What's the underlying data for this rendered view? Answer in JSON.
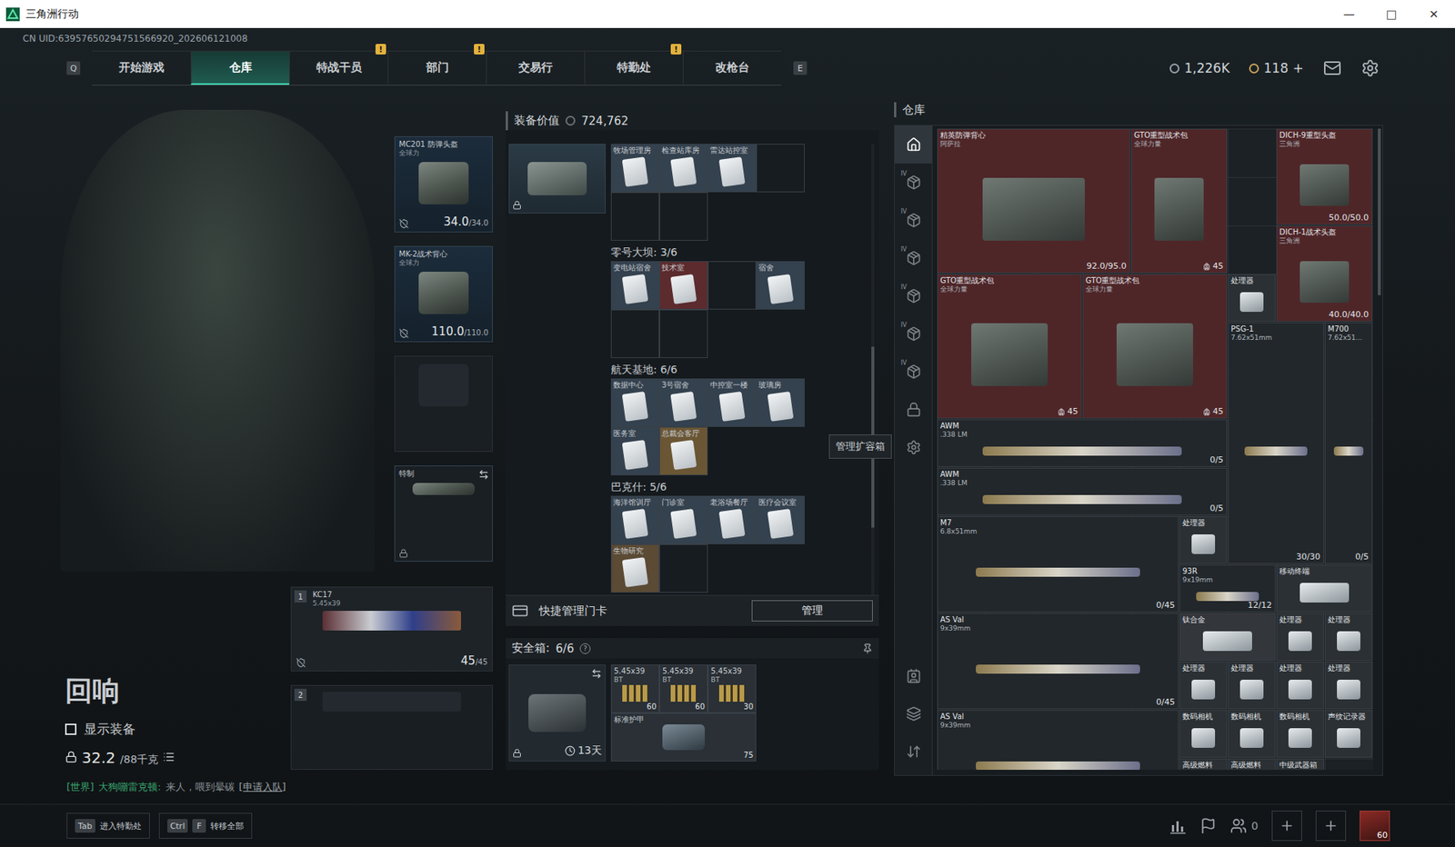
{
  "window": {
    "title": "三角洲行动",
    "controls": [
      "—",
      "□",
      "✕"
    ]
  },
  "uid": "CN UID:63957650294751566920_202606121008",
  "nav": {
    "prev_key": "Q",
    "next_key": "E",
    "alert_mark": "!",
    "tabs": [
      {
        "label": "开始游戏",
        "selected": false,
        "alert": false
      },
      {
        "label": "仓库",
        "selected": true,
        "alert": false
      },
      {
        "label": "特战干员",
        "selected": false,
        "alert": true
      },
      {
        "label": "部门",
        "selected": false,
        "alert": true
      },
      {
        "label": "交易行",
        "selected": false,
        "alert": false
      },
      {
        "label": "特勤处",
        "selected": false,
        "alert": true
      },
      {
        "label": "改枪台",
        "selected": false,
        "alert": false
      }
    ]
  },
  "currencies": [
    {
      "value": "1,226K",
      "color": "#9aa3ab"
    },
    {
      "value": "118",
      "add": "+",
      "color": "#c9a45a"
    }
  ],
  "loadout": {
    "gear": [
      {
        "kind": "armor",
        "name": "MC201 防弹头盔",
        "faction": "全球力",
        "reading": "34.0",
        "max": "/34.0"
      },
      {
        "kind": "armor",
        "name": "MK-2战术背心",
        "faction": "全球力",
        "reading": "110.0",
        "max": "/110.0"
      },
      {
        "kind": "empty"
      },
      {
        "kind": "melee",
        "name": "特制"
      }
    ],
    "weapons": [
      {
        "index": "1",
        "empty": false,
        "name": "KC17",
        "caliber": "5.45x39",
        "reading": "45",
        "max": "/45"
      },
      {
        "index": "2",
        "empty": true
      }
    ]
  },
  "operator": {
    "name": "回响",
    "show_gear": {
      "label": "显示装备",
      "checked": false
    },
    "weight": "32.2",
    "weight_max": "/88千克"
  },
  "chat": {
    "channel": "[世界]",
    "sender": "大狗嘣雷克顿:",
    "message": "来人，喂到晕碳",
    "action": "[申请入队]"
  },
  "stash_value": {
    "label": "装备价值",
    "value": "724,762"
  },
  "keycards": {
    "scroll_level": 0.45,
    "groups": [
      {
        "cards": [
          {
            "filled": true,
            "label": "牧场管理房",
            "color": "#34414e"
          },
          {
            "filled": true,
            "label": "检查站库房",
            "color": "#34414e"
          },
          {
            "filled": true,
            "label": "雷达站控室",
            "color": "#34414e"
          },
          {
            "filled": false
          },
          {
            "filled": false
          },
          {
            "filled": false
          }
        ]
      },
      {
        "heading": "零号大坝: 3/6",
        "cards": [
          {
            "filled": true,
            "label": "变电站宿舍",
            "color": "#34414e"
          },
          {
            "filled": true,
            "label": "技术室",
            "color": "#5c2b2e"
          },
          {
            "filled": false
          },
          {
            "filled": true,
            "label": "宿舍",
            "color": "#34414e"
          },
          {
            "filled": false
          },
          {
            "filled": false
          }
        ]
      },
      {
        "heading": "航天基地: 6/6",
        "cards": [
          {
            "filled": true,
            "label": "数据中心",
            "color": "#34414e"
          },
          {
            "filled": true,
            "label": "3号宿舍",
            "color": "#34414e"
          },
          {
            "filled": true,
            "label": "中控室一楼",
            "color": "#34414e"
          },
          {
            "filled": true,
            "label": "玻璃房",
            "color": "#34414e"
          },
          {
            "filled": true,
            "label": "医务室",
            "color": "#34414e"
          },
          {
            "filled": true,
            "label": "总裁会客厅",
            "color": "#6a5634"
          }
        ]
      },
      {
        "heading": "巴克什: 5/6",
        "cards": [
          {
            "filled": true,
            "label": "海洋馆训厅",
            "color": "#34414e"
          },
          {
            "filled": true,
            "label": "门诊室",
            "color": "#34414e"
          },
          {
            "filled": true,
            "label": "老浴场餐厅",
            "color": "#34414e"
          },
          {
            "filled": true,
            "label": "医疗会议室",
            "color": "#34414e"
          },
          {
            "filled": true,
            "label": "生物研究",
            "color": "#5b4a34"
          },
          {
            "filled": false
          }
        ]
      }
    ]
  },
  "quick_manage": {
    "label": "快捷管理门卡",
    "button": "管理"
  },
  "tooltip": "管理扩容箱",
  "safe_box": {
    "label": "安全箱:",
    "count": "6/6",
    "help": "?",
    "timer": "13天",
    "items": [
      {
        "kind": "ammo",
        "name": "5.45x39",
        "sub": "BT",
        "count": "60"
      },
      {
        "kind": "ammo",
        "name": "5.45x39",
        "sub": "BT",
        "count": "60"
      },
      {
        "kind": "ammo",
        "name": "5.45x39",
        "sub": "BT",
        "count": "30"
      },
      {
        "kind": "armor",
        "name": "标准护甲",
        "count": "75"
      }
    ]
  },
  "warehouse": {
    "title": "仓库",
    "sidebar": [
      {
        "kind": "home",
        "selected": true
      },
      {
        "kind": "box",
        "badge": "IV",
        "selected": false
      },
      {
        "kind": "box",
        "badge": "IV",
        "selected": false
      },
      {
        "kind": "box",
        "badge": "IV",
        "selected": false
      },
      {
        "kind": "box",
        "badge": "IV",
        "selected": false
      },
      {
        "kind": "box",
        "badge": "IV",
        "selected": false
      },
      {
        "kind": "box",
        "badge": "IV",
        "selected": false
      },
      {
        "kind": "lock",
        "selected": false
      },
      {
        "kind": "settings",
        "selected": false
      }
    ],
    "tools": [
      {
        "kind": "contact"
      },
      {
        "kind": "layers"
      },
      {
        "kind": "sort"
      }
    ],
    "items": [
      {
        "kind": "armor",
        "name": "精英防弹背心",
        "sub": "阿萨拉",
        "reading": "92.0/95.0",
        "color": "#4f2628"
      },
      {
        "kind": "bag",
        "name": "GTO重型战术包",
        "sub": "全球力量",
        "reading": "45",
        "color": "#4f2628"
      },
      {
        "kind": "armor",
        "name": "DICH-9重型头盔",
        "sub": "三角洲",
        "reading": "50.0/50.0",
        "color": "#4f2628"
      },
      {
        "kind": "armor",
        "name": "DICH-1战术头盔",
        "sub": "三角洲",
        "reading": "40.0/40.0",
        "color": "#4f2628"
      },
      {
        "kind": "bag",
        "name": "GTO重型战术包",
        "sub": "全球力量",
        "reading": "45",
        "color": "#4f2628"
      },
      {
        "kind": "bag",
        "name": "GTO重型战术包",
        "sub": "全球力量",
        "reading": "45",
        "color": "#4f2628"
      },
      {
        "kind": "item",
        "name": "处理器",
        "color": "#2b3034"
      },
      {
        "kind": "gun",
        "name": "PSG-1",
        "sub": "7.62x51mm",
        "reading": "30/30",
        "color": "#22272b"
      },
      {
        "kind": "gun",
        "name": "M700",
        "sub": "7.62x51...",
        "reading": "0/5",
        "color": "#22272b"
      },
      {
        "kind": "gun",
        "name": "AWM",
        "sub": ".338 LM",
        "reading": "0/5",
        "color": "#22272b"
      },
      {
        "kind": "gun",
        "name": "AWM",
        "sub": ".338 LM",
        "reading": "0/5",
        "color": "#22272b"
      },
      {
        "kind": "gun",
        "name": "M7",
        "sub": "6.8x51mm",
        "reading": "0/45",
        "color": "#22272b"
      },
      {
        "kind": "item",
        "name": "处理器",
        "color": "#2b3034"
      },
      {
        "kind": "gun",
        "name": "93R",
        "sub": "9x19mm",
        "reading": "12/12",
        "color": "#22272b"
      },
      {
        "kind": "item",
        "name": "移动终端",
        "color": "#2b3034"
      },
      {
        "kind": "gun",
        "name": "AS Val",
        "sub": "9x39mm",
        "reading": "0/45",
        "color": "#22272b"
      },
      {
        "kind": "item",
        "name": "钛合金",
        "color": "#33363b"
      },
      {
        "kind": "item",
        "name": "处理器",
        "color": "#2b3034"
      },
      {
        "kind": "item",
        "name": "处理器",
        "color": "#2b3034"
      },
      {
        "kind": "item",
        "name": "处理器",
        "color": "#2b3034"
      },
      {
        "kind": "item",
        "name": "处理器",
        "color": "#2b3034"
      },
      {
        "kind": "item",
        "name": "处理器",
        "color": "#2b3034"
      },
      {
        "kind": "item",
        "name": "处理器",
        "color": "#2b3034"
      },
      {
        "kind": "gun",
        "name": "AS Val",
        "sub": "9x39mm",
        "color": "#22272b"
      },
      {
        "kind": "item",
        "name": "数码相机",
        "color": "#2b3034"
      },
      {
        "kind": "item",
        "name": "数码相机",
        "color": "#2b3034"
      },
      {
        "kind": "item",
        "name": "数码相机",
        "color": "#2b3034"
      },
      {
        "kind": "item",
        "name": "声纹记录器",
        "color": "#2b3034"
      },
      {
        "kind": "item",
        "name": "高级燃料",
        "color": "#2b3034"
      },
      {
        "kind": "item",
        "name": "高级燃料",
        "color": "#2b3034"
      },
      {
        "kind": "item",
        "name": "中级武器箱",
        "color": "#2b3034"
      }
    ]
  },
  "bottom_bar": {
    "hints": [
      {
        "keys": [
          "Tab"
        ],
        "label": "进入特勤处"
      },
      {
        "keys": [
          "Ctrl",
          "F"
        ],
        "label": "转移全部"
      }
    ],
    "friends": "0",
    "level": "60"
  }
}
